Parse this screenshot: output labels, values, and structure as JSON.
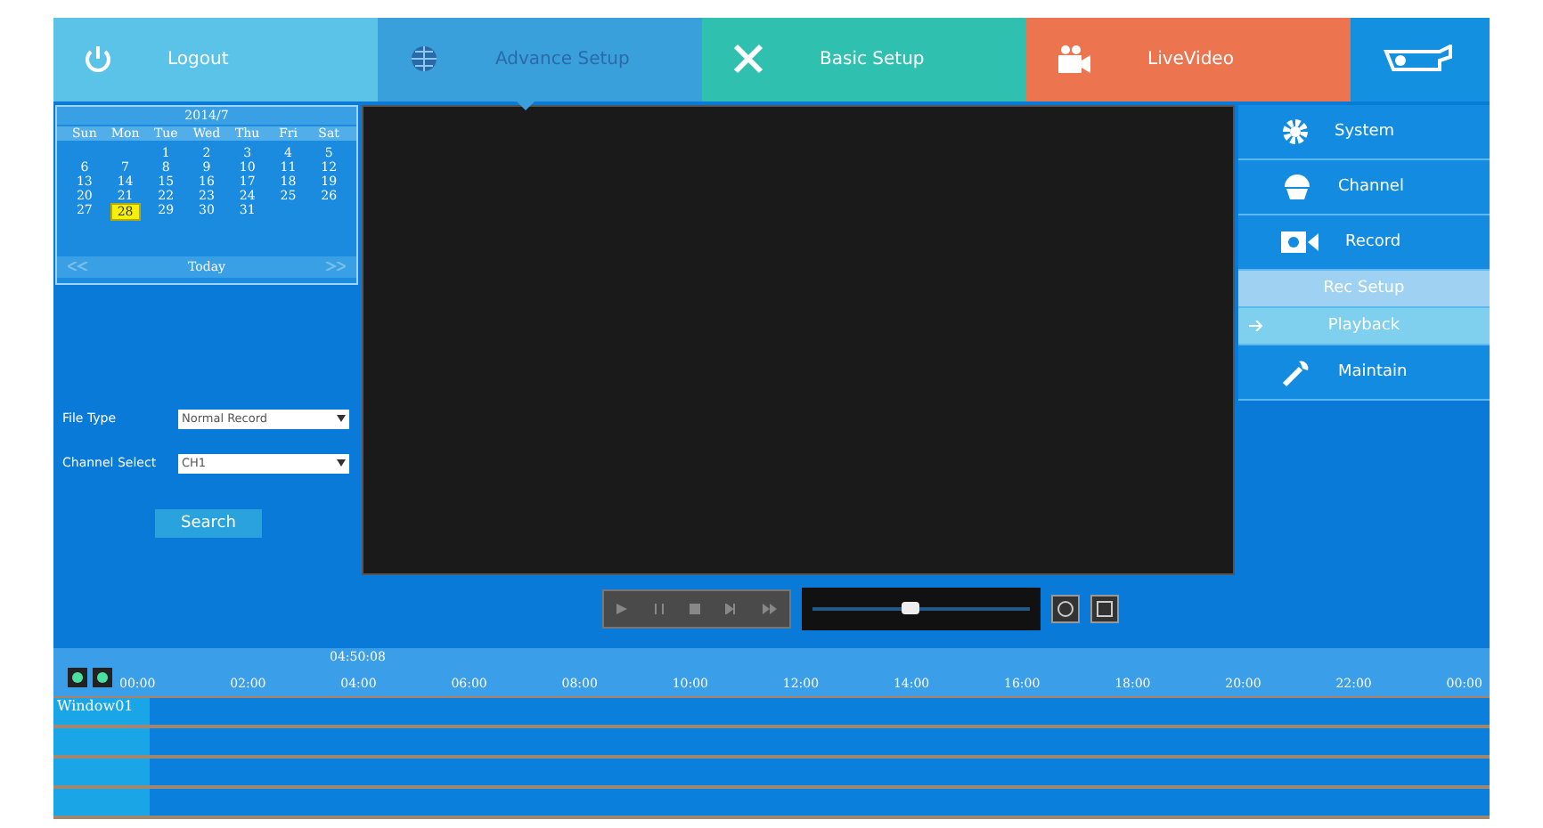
{
  "header_tabs": [
    {
      "label": "Logout",
      "kind": "logout",
      "selected": false
    },
    {
      "label": "Advance Setup",
      "kind": "advance",
      "selected": true
    },
    {
      "label": "Basic Setup",
      "kind": "basic",
      "selected": false
    },
    {
      "label": "LiveVideo",
      "kind": "live",
      "selected": false
    }
  ],
  "calendar": {
    "title": "2014/7",
    "weekdays": [
      "Sun",
      "Mon",
      "Tue",
      "Wed",
      "Thu",
      "Fri",
      "Sat"
    ],
    "weeks": [
      {
        "kind": "partial",
        "days": [
          {
            "day": "1",
            "selected": false
          },
          {
            "day": "2",
            "selected": false
          },
          {
            "day": "3",
            "selected": false
          },
          {
            "day": "4",
            "selected": false
          },
          {
            "day": "5",
            "selected": false
          }
        ]
      },
      {
        "kind": "full",
        "days": [
          {
            "day": "6",
            "selected": false
          },
          {
            "day": "7",
            "selected": false
          },
          {
            "day": "8",
            "selected": false
          },
          {
            "day": "9",
            "selected": false
          },
          {
            "day": "10",
            "selected": false
          },
          {
            "day": "11",
            "selected": false
          },
          {
            "day": "12",
            "selected": false
          }
        ]
      },
      {
        "kind": "full",
        "days": [
          {
            "day": "13",
            "selected": false
          },
          {
            "day": "14",
            "selected": false
          },
          {
            "day": "15",
            "selected": false
          },
          {
            "day": "16",
            "selected": false
          },
          {
            "day": "17",
            "selected": false
          },
          {
            "day": "18",
            "selected": false
          },
          {
            "day": "19",
            "selected": false
          }
        ]
      },
      {
        "kind": "full",
        "days": [
          {
            "day": "20",
            "selected": false
          },
          {
            "day": "21",
            "selected": false
          },
          {
            "day": "22",
            "selected": false
          },
          {
            "day": "23",
            "selected": false
          },
          {
            "day": "24",
            "selected": false
          },
          {
            "day": "25",
            "selected": false
          },
          {
            "day": "26",
            "selected": false
          }
        ]
      },
      {
        "kind": "last",
        "days": [
          {
            "day": "27",
            "selected": false
          },
          {
            "day": "28",
            "selected": true
          },
          {
            "day": "29",
            "selected": false
          },
          {
            "day": "30",
            "selected": false
          },
          {
            "day": "31",
            "selected": false
          }
        ]
      }
    ],
    "today_label": "Today"
  },
  "search_form": {
    "fields": [
      {
        "label": "File Type",
        "value": "Normal Record"
      },
      {
        "label": "Channel Select",
        "value": "CH1"
      }
    ],
    "button": "Search"
  },
  "menu": [
    {
      "label": "System",
      "kind": "gear"
    },
    {
      "label": "Channel",
      "kind": "camera"
    },
    {
      "label": "Record",
      "kind": "record",
      "children": [
        {
          "label": "Rec Setup",
          "selected": false
        },
        {
          "label": "Playback",
          "selected": true
        }
      ]
    },
    {
      "label": "Maintain",
      "kind": "wrench"
    }
  ],
  "speed": {
    "level": 0.45
  },
  "timeline": {
    "cursor": "04:50:08",
    "ticks": [
      "00:00",
      "02:00",
      "04:00",
      "06:00",
      "08:00",
      "10:00",
      "12:00",
      "14:00",
      "16:00",
      "18:00",
      "20:00",
      "22:00",
      "00:00"
    ],
    "rows": [
      {
        "label": "Window01"
      },
      {},
      {},
      {}
    ]
  }
}
